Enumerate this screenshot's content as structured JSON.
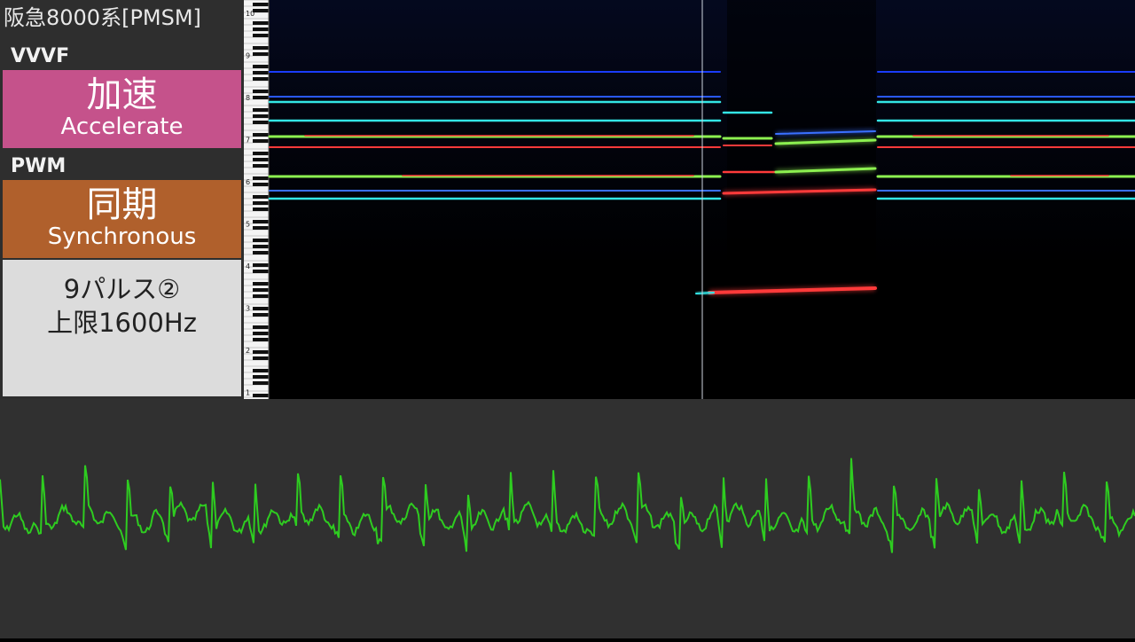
{
  "title": "阪急8000系[PMSM]",
  "vvvf": {
    "label": "VVVF",
    "mode_jp": "加速",
    "mode_en": "Accelerate",
    "color": "#c5528b"
  },
  "pwm": {
    "label": "PWM",
    "mode_jp": "同期",
    "mode_en": "Synchronous",
    "color": "#b0602c"
  },
  "info": {
    "line1": "9パルス②",
    "line2": "上限1600Hz"
  },
  "spectrogram": {
    "octave_labels": [
      "10",
      "9",
      "8",
      "7",
      "6",
      "5",
      "4",
      "3",
      "2",
      "1"
    ],
    "colors": {
      "background": "#000000",
      "band_cyan": "#33e6e6",
      "band_green": "#8cf050",
      "band_red": "#ff3a3a"
    }
  },
  "waveform": {
    "color": "#2ecc20"
  }
}
